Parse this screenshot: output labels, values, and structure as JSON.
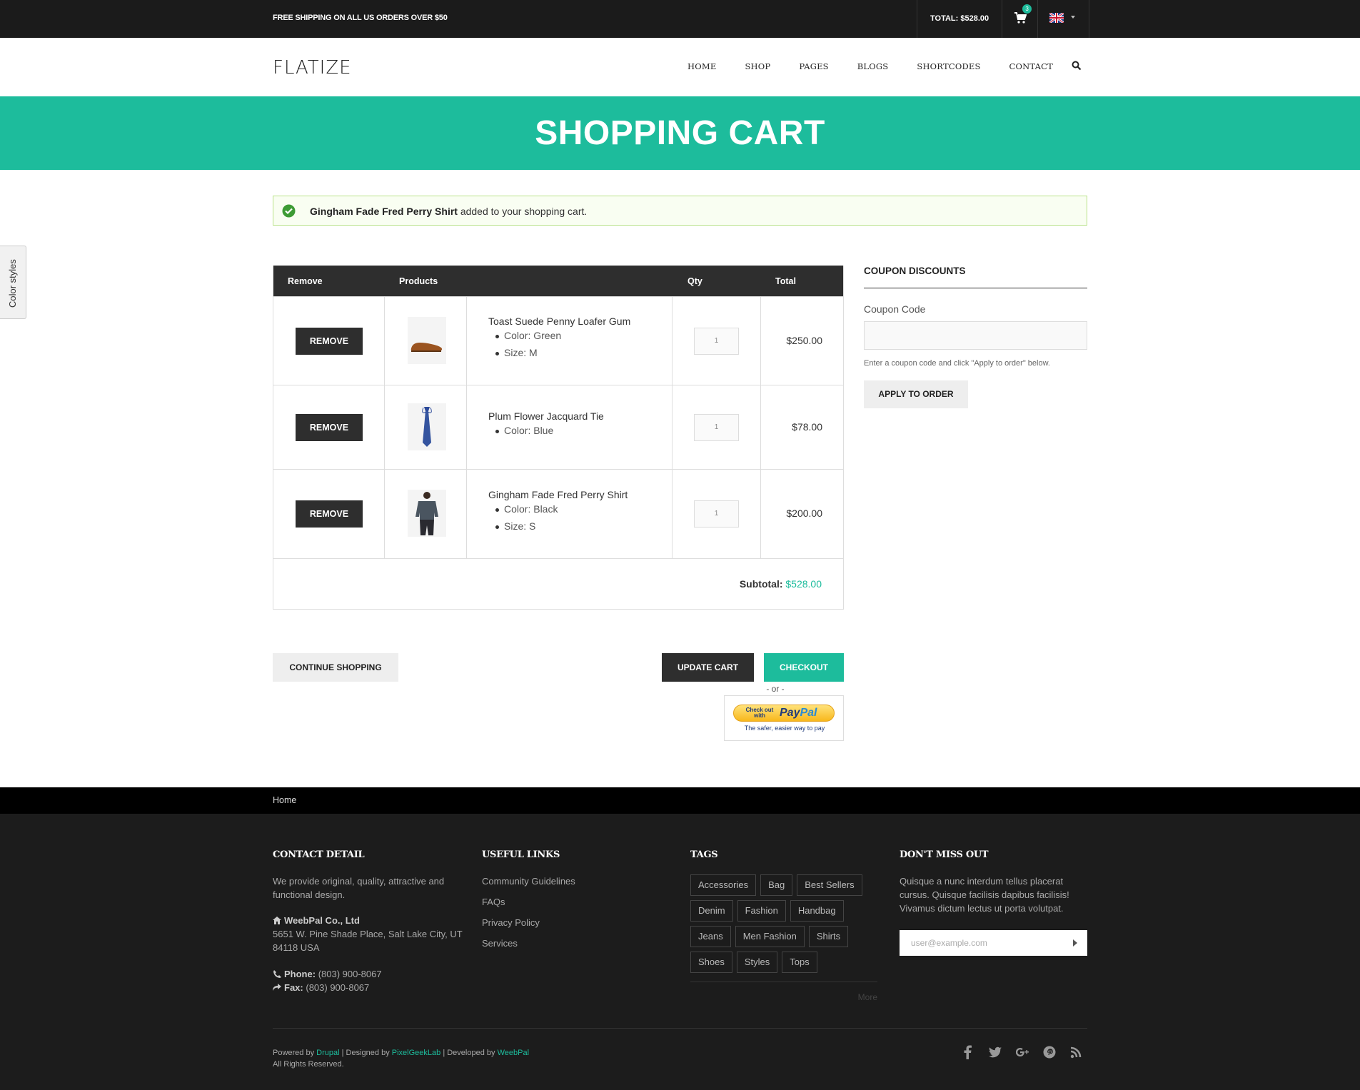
{
  "topbar": {
    "promo": "FREE SHIPPING ON ALL US ORDERS OVER $50",
    "total": "TOTAL: $528.00",
    "cart_count": "3",
    "icons": {
      "cart": "cart-icon",
      "language": "uk-flag-icon"
    }
  },
  "header": {
    "logo": "FLATIZE",
    "nav": [
      "HOME",
      "SHOP",
      "PAGES",
      "BLOGS",
      "SHORTCODES",
      "CONTACT"
    ]
  },
  "banner": {
    "title": "SHOPPING CART"
  },
  "message": {
    "product": "Gingham Fade Fred Perry Shirt",
    "suffix": "added to your shopping cart."
  },
  "cart": {
    "headers": {
      "remove": "Remove",
      "products": "Products",
      "qty": "Qty",
      "total": "Total"
    },
    "remove_label": "REMOVE",
    "items": [
      {
        "name": "Toast Suede Penny Loafer Gum",
        "attrs": [
          "Color: Green",
          "Size: M"
        ],
        "qty": "1",
        "total": "$250.00"
      },
      {
        "name": "Plum Flower Jacquard Tie",
        "attrs": [
          "Color: Blue"
        ],
        "qty": "1",
        "total": "$78.00"
      },
      {
        "name": "Gingham Fade Fred Perry Shirt",
        "attrs": [
          "Color: Black",
          "Size: S"
        ],
        "qty": "1",
        "total": "$200.00"
      }
    ],
    "subtotal_label": "Subtotal:",
    "subtotal_value": "$528.00"
  },
  "coupon": {
    "title": "COUPON DISCOUNTS",
    "label": "Coupon Code",
    "value": "",
    "hint": "Enter a coupon code and click \"Apply to order\" below.",
    "apply_label": "APPLY TO ORDER"
  },
  "actions": {
    "continue": "CONTINUE SHOPPING",
    "update": "UPDATE CART",
    "checkout": "CHECKOUT",
    "or": "- or -",
    "paypal_small": "Check out with",
    "paypal_logo_a": "Pay",
    "paypal_logo_b": "Pal",
    "paypal_tag": "The safer, easier way to pay"
  },
  "breadcrumb": {
    "home": "Home"
  },
  "footer": {
    "contact": {
      "title": "CONTACT DETAIL",
      "desc": "We provide original, quality, attractive and functional design.",
      "company": "WeebPal Co., Ltd",
      "address": "5651 W. Pine Shade Place, Salt Lake City, UT 84118 USA",
      "phone_label": "Phone:",
      "phone": "(803) 900-8067",
      "fax_label": "Fax:",
      "fax": "(803) 900-8067"
    },
    "links": {
      "title": "USEFUL LINKS",
      "items": [
        "Community Guidelines",
        "FAQs",
        "Privacy Policy",
        "Services"
      ]
    },
    "tags": {
      "title": "TAGS",
      "items": [
        "Accessories",
        "Bag",
        "Best Sellers",
        "Denim",
        "Fashion",
        "Handbag",
        "Jeans",
        "Men Fashion",
        "Shirts",
        "Shoes",
        "Styles",
        "Tops"
      ],
      "more": "More"
    },
    "newsletter": {
      "title": "DON'T MISS OUT",
      "desc": "Quisque a nunc interdum tellus placerat cursus. Quisque facilisis dapibus facilisis! Vivamus dictum lectus ut porta volutpat.",
      "placeholder": "user@example.com"
    },
    "credits": {
      "powered": "Powered by",
      "drupal": "Drupal",
      "designed": "| Designed by",
      "pgl": "PixelGeekLab",
      "developed": "| Developed by",
      "weebpal": "WeebPal",
      "rights": "All Rights Reserved."
    },
    "social": [
      "facebook-icon",
      "twitter-icon",
      "google-plus-icon",
      "pinterest-icon",
      "rss-icon"
    ]
  },
  "sidetab": {
    "label": "Color styles"
  }
}
